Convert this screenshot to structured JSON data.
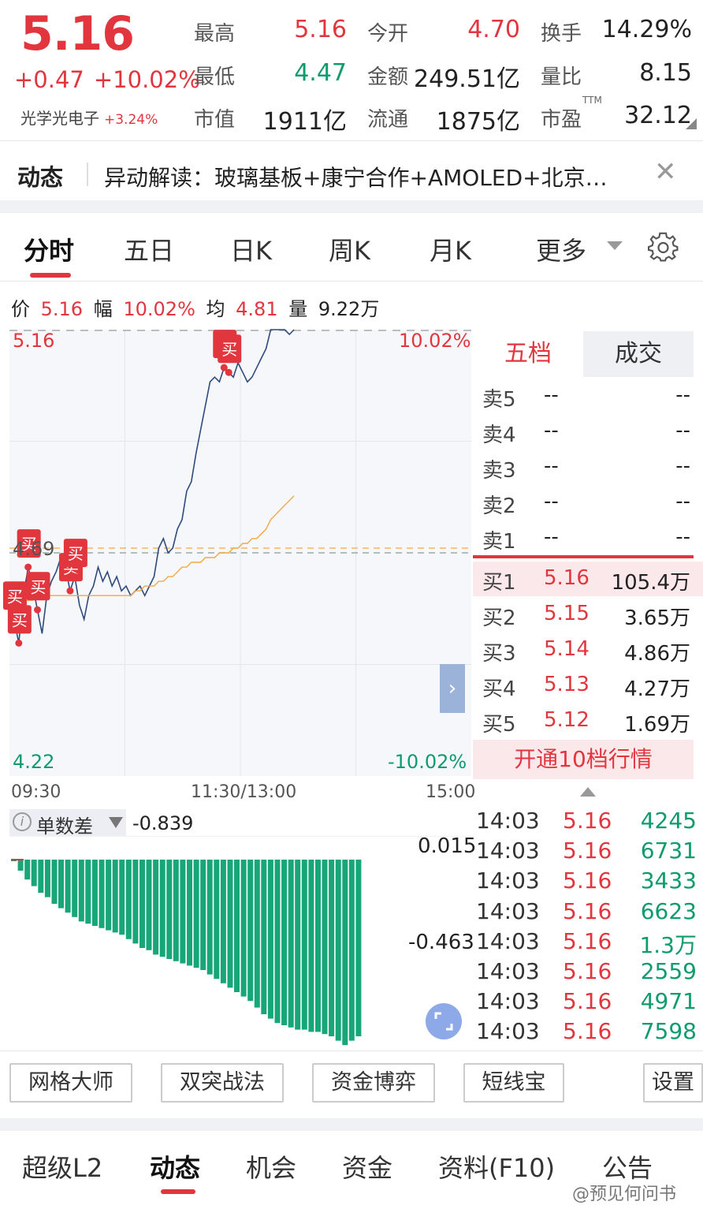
{
  "quote": {
    "price": "5.16",
    "change": "+0.47",
    "change_pct": "+10.02%",
    "sector_name": "光学光电子",
    "sector_pct": "+3.24%",
    "stats": [
      {
        "label": "最高",
        "value": "5.16",
        "color": "red"
      },
      {
        "label": "今开",
        "value": "4.70",
        "color": "red"
      },
      {
        "label": "换手",
        "value": "14.29%",
        "color": "black"
      },
      {
        "label": "最低",
        "value": "4.47",
        "color": "green"
      },
      {
        "label": "金额",
        "value": "249.51亿",
        "color": "black"
      },
      {
        "label": "量比",
        "value": "8.15",
        "color": "black"
      },
      {
        "label": "市值",
        "value": "1911亿",
        "color": "black"
      },
      {
        "label": "流通",
        "value": "1875亿",
        "color": "black"
      },
      {
        "label": "市盈",
        "value": "32.12",
        "color": "black"
      }
    ],
    "ttm_label": "TTM"
  },
  "dynamic": {
    "title": "动态",
    "text": "异动解读：玻璃基板+康宁合作+AMOLED+北京…",
    "close_glyph": "✕"
  },
  "tabs": [
    "分时",
    "五日",
    "日K",
    "周K",
    "月K",
    "更多"
  ],
  "info_line": {
    "price_label": "价",
    "price": "5.16",
    "range_label": "幅",
    "range": "10.02%",
    "avg_label": "均",
    "avg": "4.81",
    "vol_label": "量",
    "vol": "9.22万"
  },
  "chart_labels": {
    "top_price": "5.16",
    "top_pct": "10.02%",
    "mid_price": "4.69",
    "bottom_price": "4.22",
    "bottom_pct": "-10.02%",
    "times": [
      "09:30",
      "11:30/13:00",
      "15:00"
    ],
    "buy_mark": "买",
    "expand_glyph": "›"
  },
  "chart_data": {
    "type": "line",
    "title": "",
    "ylim": [
      4.22,
      5.16
    ],
    "prev_close": 4.69,
    "series": [
      {
        "values": [
          4.62,
          4.55,
          4.5,
          4.6,
          4.66,
          4.62,
          4.57,
          4.52,
          4.6,
          4.63,
          4.65,
          4.68,
          4.66,
          4.61,
          4.64,
          4.58,
          4.55,
          4.6,
          4.62,
          4.66,
          4.63,
          4.65,
          4.62,
          4.64,
          4.61,
          4.62,
          4.6,
          4.61,
          4.62,
          4.6,
          4.62,
          4.64,
          4.7,
          4.72,
          4.69,
          4.7,
          4.74,
          4.76,
          4.82,
          4.84,
          4.9,
          4.95,
          5.0,
          5.05,
          5.06,
          5.05,
          5.08,
          5.07,
          5.06,
          5.09,
          5.07,
          5.05,
          5.06,
          5.08,
          5.1,
          5.12,
          5.16,
          5.16,
          5.16,
          5.16,
          5.15,
          5.16
        ]
      },
      {
        "values": [
          4.6,
          4.6,
          4.59,
          4.59,
          4.59,
          4.59,
          4.6,
          4.6,
          4.6,
          4.6,
          4.6,
          4.6,
          4.6,
          4.6,
          4.6,
          4.6,
          4.6,
          4.6,
          4.6,
          4.6,
          4.6,
          4.6,
          4.6,
          4.6,
          4.6,
          4.6,
          4.6,
          4.61,
          4.61,
          4.62,
          4.62,
          4.62,
          4.63,
          4.63,
          4.64,
          4.64,
          4.65,
          4.66,
          4.66,
          4.67,
          4.67,
          4.67,
          4.68,
          4.68,
          4.68,
          4.69,
          4.69,
          4.69,
          4.7,
          4.7,
          4.71,
          4.71,
          4.72,
          4.72,
          4.73,
          4.74,
          4.76,
          4.77,
          4.78,
          4.79,
          4.8,
          4.81
        ]
      }
    ]
  },
  "order_book": {
    "tabs": [
      "五档",
      "成交"
    ],
    "asks": [
      {
        "label": "卖5",
        "price": "--",
        "vol": "--"
      },
      {
        "label": "卖4",
        "price": "--",
        "vol": "--"
      },
      {
        "label": "卖3",
        "price": "--",
        "vol": "--"
      },
      {
        "label": "卖2",
        "price": "--",
        "vol": "--"
      },
      {
        "label": "卖1",
        "price": "--",
        "vol": "--"
      }
    ],
    "bids": [
      {
        "label": "买1",
        "price": "5.16",
        "vol": "105.4万"
      },
      {
        "label": "买2",
        "price": "5.15",
        "vol": "3.65万"
      },
      {
        "label": "买3",
        "price": "5.14",
        "vol": "4.86万"
      },
      {
        "label": "买4",
        "price": "5.13",
        "vol": "4.27万"
      },
      {
        "label": "买5",
        "price": "5.12",
        "vol": "1.69万"
      }
    ],
    "open_level": "开通10档行情"
  },
  "trades": [
    {
      "time": "14:03",
      "price": "5.16",
      "vol": "4245"
    },
    {
      "time": "14:03",
      "price": "5.16",
      "vol": "6731"
    },
    {
      "time": "14:03",
      "price": "5.16",
      "vol": "3433"
    },
    {
      "time": "14:03",
      "price": "5.16",
      "vol": "6623"
    },
    {
      "time": "14:03",
      "price": "5.16",
      "vol": "1.3万"
    },
    {
      "time": "14:03",
      "price": "5.16",
      "vol": "2559"
    },
    {
      "time": "14:03",
      "price": "5.16",
      "vol": "4971"
    },
    {
      "time": "14:03",
      "price": "5.16",
      "vol": "7598"
    }
  ],
  "indicator": {
    "info_glyph": "i",
    "name": "单数差",
    "value": "-0.839",
    "top": "0.015",
    "mid": "-0.463",
    "bars": [
      0.0,
      -0.05,
      -0.09,
      -0.12,
      -0.15,
      -0.17,
      -0.2,
      -0.22,
      -0.24,
      -0.26,
      -0.28,
      -0.29,
      -0.3,
      -0.31,
      -0.32,
      -0.33,
      -0.34,
      -0.36,
      -0.38,
      -0.4,
      -0.41,
      -0.43,
      -0.44,
      -0.45,
      -0.46,
      -0.47,
      -0.48,
      -0.49,
      -0.5,
      -0.52,
      -0.54,
      -0.56,
      -0.58,
      -0.6,
      -0.62,
      -0.64,
      -0.67,
      -0.7,
      -0.72,
      -0.74,
      -0.75,
      -0.76,
      -0.77,
      -0.77,
      -0.78,
      -0.78,
      -0.79,
      -0.8,
      -0.82,
      -0.84,
      -0.82,
      -0.8
    ]
  },
  "tools": [
    "网格大师",
    "双突战法",
    "资金博弈",
    "短线宝",
    "设置"
  ],
  "bottom_tabs": [
    "超级L2",
    "动态",
    "机会",
    "资金",
    "资料(F10)",
    "公告"
  ],
  "watermark": "@预见何问书",
  "colors": {
    "up": "#e2363f",
    "down": "#0f9b6b",
    "price_line": "#2f4a7c",
    "avg_line": "#f0a84a"
  }
}
